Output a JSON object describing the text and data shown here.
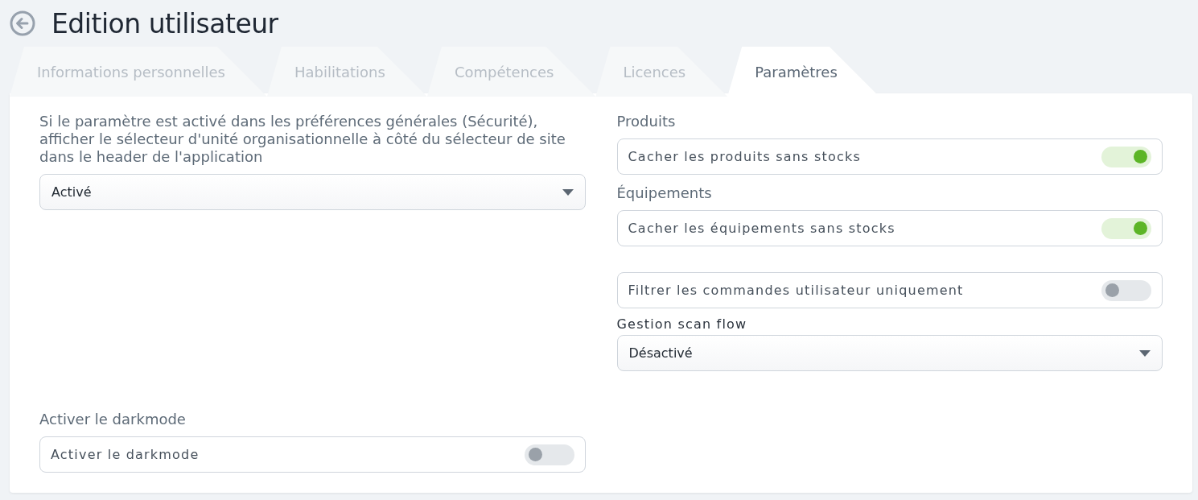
{
  "header": {
    "title": "Edition utilisateur"
  },
  "tabs": [
    {
      "label": "Informations personnelles",
      "selected": false
    },
    {
      "label": "Habilitations",
      "selected": false
    },
    {
      "label": "Compétences",
      "selected": false
    },
    {
      "label": "Licences",
      "selected": false
    },
    {
      "label": "Paramètres",
      "selected": true
    }
  ],
  "columns": [
    {
      "groups": [
        {
          "heading": "Si le paramètre est activé dans les préférences générales (Sécurité), afficher le sélecteur d'unité organisationnelle à côté du sélecteur de site dans le header de l'application",
          "controls": [
            {
              "kind": "select",
              "value": "Activé"
            }
          ]
        },
        {
          "heading": "Activer le darkmode",
          "controls": [
            {
              "kind": "toggle",
              "label": "Activer le darkmode",
              "on": false
            }
          ]
        }
      ]
    },
    {
      "groups": [
        {
          "heading": "Produits",
          "controls": [
            {
              "kind": "toggle",
              "label": "Cacher les produits sans stocks",
              "on": true
            }
          ]
        },
        {
          "heading": "Équipements",
          "controls": [
            {
              "kind": "toggle",
              "label": "Cacher les équipements sans stocks",
              "on": true
            }
          ]
        },
        {
          "controls": [
            {
              "kind": "toggle",
              "label": "Filtrer les commandes utilisateur uniquement",
              "on": false
            },
            {
              "kind": "label",
              "text": "Gestion scan flow"
            },
            {
              "kind": "select",
              "value": "Désactivé"
            }
          ]
        }
      ]
    }
  ]
}
